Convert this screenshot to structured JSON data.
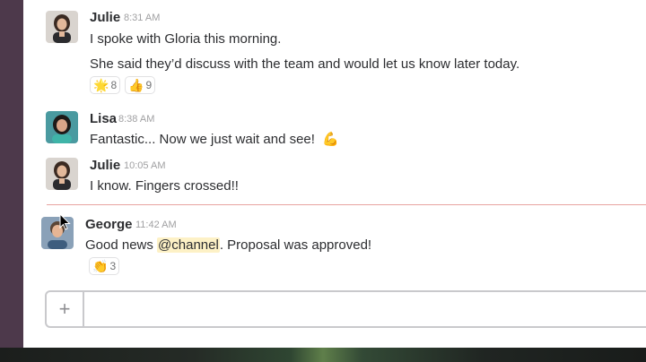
{
  "messages": [
    {
      "author": "Julie",
      "time": "8:31 AM",
      "lines": [
        "I spoke with Gloria this morning.",
        "She said they’d discuss with the team and would let us know later today."
      ],
      "reactions": [
        {
          "emoji": "🌟",
          "count": "8"
        },
        {
          "emoji": "👍",
          "count": "9"
        }
      ]
    },
    {
      "author": "Lisa",
      "time": "8:38 AM",
      "lines": [
        "Fantastic... Now we just wait and see!"
      ],
      "emoji": "💪"
    },
    {
      "author": "Julie",
      "time": "10:05 AM",
      "lines": [
        "I know. Fingers crossed!!"
      ]
    },
    {
      "author": "George",
      "time": "11:42 AM",
      "text_before": "Good news ",
      "mention": "@channel",
      "text_after": ". Proposal was approved!",
      "reactions": [
        {
          "emoji": "👏",
          "count": "3"
        }
      ]
    }
  ],
  "composer": {
    "add_icon": "plus-icon",
    "placeholder": ""
  },
  "colors": {
    "sidebar": "#4d394b",
    "new_messages_divider": "#e8a3a0",
    "mention_highlight": "#fdf1c6"
  }
}
